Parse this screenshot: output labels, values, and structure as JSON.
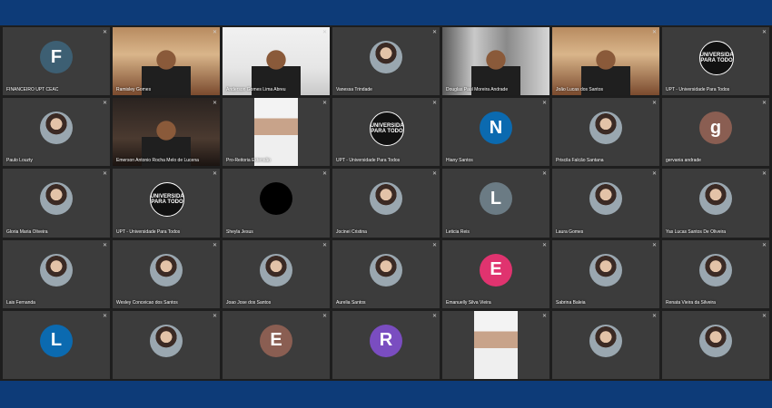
{
  "participants": [
    {
      "name": "FINANCEIRO UPT CEAC",
      "type": "initial",
      "initial": "F",
      "color": "#3d5f73"
    },
    {
      "name": "Ramisley Gomes",
      "type": "video",
      "video": "room"
    },
    {
      "name": "Anderson Gomes Lima Abreu",
      "type": "video",
      "video": "white"
    },
    {
      "name": "Vanessa Trindade",
      "type": "photo"
    },
    {
      "name": "Douglas Paul Moreira Andrade",
      "type": "video",
      "video": "library"
    },
    {
      "name": "João Lucas dos Santos",
      "type": "video",
      "video": "room"
    },
    {
      "name": "UPT - Universidade Para Todos",
      "type": "logo"
    },
    {
      "name": "Paulo Louzty",
      "type": "photo"
    },
    {
      "name": "Emerson Antonio Rocha Melo de Lucena",
      "type": "video",
      "video": "dark",
      "speaking": true
    },
    {
      "name": "Pro-Reitoria Extensão",
      "type": "video",
      "video": "strip"
    },
    {
      "name": "UPT - Universidade Para Todos",
      "type": "logo"
    },
    {
      "name": "Hiany Santos",
      "type": "initial",
      "initial": "N",
      "color": "#0b6ab0"
    },
    {
      "name": "Priscila Falcão Santana",
      "type": "photo"
    },
    {
      "name": "gervania andrade",
      "type": "initial",
      "initial": "g",
      "color": "#8a5e52"
    },
    {
      "name": "Gloria Maria Oliveira",
      "type": "photo"
    },
    {
      "name": "UPT - Universidade Para Todos",
      "type": "logo"
    },
    {
      "name": "Sheyla Jesus",
      "type": "black"
    },
    {
      "name": "Jocinei Cristina",
      "type": "photo"
    },
    {
      "name": "Leticia Reis",
      "type": "initial",
      "initial": "L",
      "color": "#6b7b84"
    },
    {
      "name": "Laura Gomes",
      "type": "photo"
    },
    {
      "name": "Yas Lucas Santos De Oliveira",
      "type": "photo"
    },
    {
      "name": "Lais Fernanda",
      "type": "photo"
    },
    {
      "name": "Wesley Conceicao dos Santos",
      "type": "photo"
    },
    {
      "name": "Joao Jose dos Santos",
      "type": "photo"
    },
    {
      "name": "Aurelia Santos",
      "type": "photo"
    },
    {
      "name": "Emanuelly Silva Vieira",
      "type": "initial",
      "initial": "E",
      "color": "#e0336f"
    },
    {
      "name": "Sabrina Baleia",
      "type": "photo"
    },
    {
      "name": "Renata Vieira da Silveira",
      "type": "photo"
    },
    {
      "name": "",
      "type": "initial",
      "initial": "L",
      "color": "#0b6ab0"
    },
    {
      "name": "",
      "type": "photo"
    },
    {
      "name": "",
      "type": "initial",
      "initial": "E",
      "color": "#8a5e52"
    },
    {
      "name": "",
      "type": "initial",
      "initial": "R",
      "color": "#7a4dc0"
    },
    {
      "name": "",
      "type": "video",
      "video": "strip"
    },
    {
      "name": "",
      "type": "photo"
    },
    {
      "name": "",
      "type": "photo"
    }
  ],
  "logo_text": "UNIVERSIDA PARA TODO",
  "mic_icon": "mic-muted-icon",
  "colors": {
    "frame": "#0d3b78",
    "tile": "#3c3c3c",
    "speaking": "#4a8cff"
  }
}
